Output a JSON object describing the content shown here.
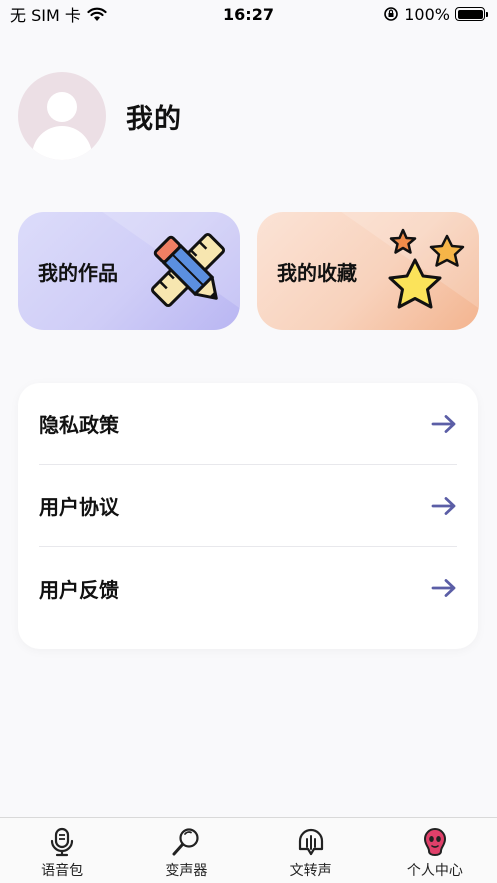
{
  "status_bar": {
    "carrier": "无 SIM 卡",
    "time": "16:27",
    "battery": "100%",
    "battery_level": 1.0,
    "icons": [
      "wifi-icon",
      "orientation-lock-icon",
      "battery-icon"
    ]
  },
  "profile": {
    "title": "我的",
    "avatar_icon": "default-user-avatar"
  },
  "cards": [
    {
      "label": "我的作品",
      "icon": "pencil-ruler-icon",
      "color": "#cfcdf7"
    },
    {
      "label": "我的收藏",
      "icon": "stars-icon",
      "color": "#f8d2bc"
    }
  ],
  "settings": {
    "items": [
      {
        "label": "隐私政策",
        "icon": "arrow-right-icon"
      },
      {
        "label": "用户协议",
        "icon": "arrow-right-icon"
      },
      {
        "label": "用户反馈",
        "icon": "arrow-right-icon"
      }
    ],
    "arrow_color": "#5b5ea6"
  },
  "tabbar": {
    "tabs": [
      {
        "label": "语音包",
        "icon": "microphone-icon",
        "active": false
      },
      {
        "label": "变声器",
        "icon": "magic-wand-icon",
        "active": false
      },
      {
        "label": "文转声",
        "icon": "text-to-speech-icon",
        "active": false
      },
      {
        "label": "个人中心",
        "icon": "profile-icon",
        "active": true
      }
    ],
    "active_color": "#e0406a"
  }
}
